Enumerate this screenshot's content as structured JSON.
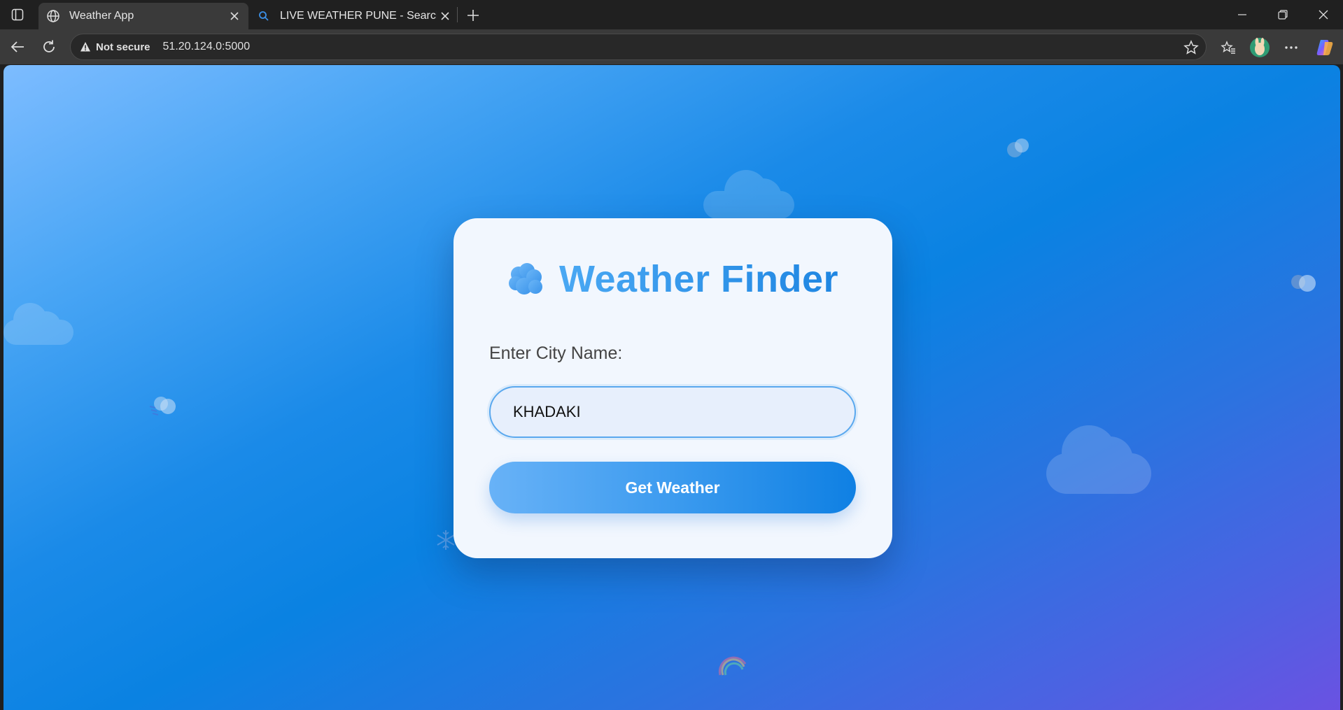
{
  "browser": {
    "tabs": [
      {
        "title": "Weather App",
        "favicon": "globe-icon",
        "active": true
      },
      {
        "title": "LIVE WEATHER PUNE - Search",
        "favicon": "search-icon",
        "active": false
      }
    ],
    "address": {
      "security_label": "Not secure",
      "url": "51.20.124.0:5000"
    }
  },
  "app": {
    "heading": "Weather Finder",
    "heading_icon": "cloud-icon",
    "city_label": "Enter City Name:",
    "city_value": "KHADAKI",
    "submit_label": "Get Weather"
  },
  "colors": {
    "accent": "#3794e8",
    "card_bg": "#f2f7fe",
    "gradient_start": "#7dbcff",
    "gradient_end": "#6a52e2"
  }
}
